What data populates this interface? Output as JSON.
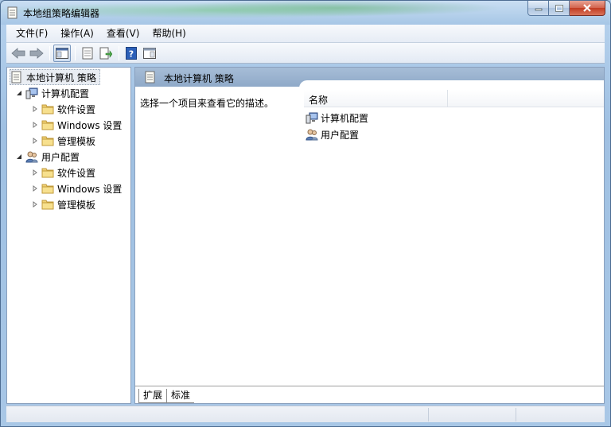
{
  "window": {
    "title": "本地组策略编辑器",
    "icon": "policy-document-icon"
  },
  "menu": [
    {
      "label": "文件(F)"
    },
    {
      "label": "操作(A)"
    },
    {
      "label": "查看(V)"
    },
    {
      "label": "帮助(H)"
    }
  ],
  "toolbar": {
    "buttons": [
      "back-arrow-icon",
      "forward-arrow-icon",
      "show-hide-tree-icon",
      "properties-icon",
      "export-list-icon",
      "help-icon",
      "show-action-pane-icon"
    ]
  },
  "tree": {
    "root": "本地计算机 策略",
    "computer": {
      "label": "计算机配置",
      "children": [
        "软件设置",
        "Windows 设置",
        "管理模板"
      ]
    },
    "user": {
      "label": "用户配置",
      "children": [
        "软件设置",
        "Windows 设置",
        "管理模板"
      ]
    }
  },
  "right": {
    "header_title": "本地计算机 策略",
    "description": "选择一个项目来查看它的描述。",
    "column_name": "名称",
    "items": [
      "计算机配置",
      "用户配置"
    ]
  },
  "tabs": [
    "扩展",
    "标准"
  ],
  "colors": {
    "header_blue": "#8fa9c8",
    "folder_yellow": "#f1d276",
    "close_red": "#c23c22"
  }
}
